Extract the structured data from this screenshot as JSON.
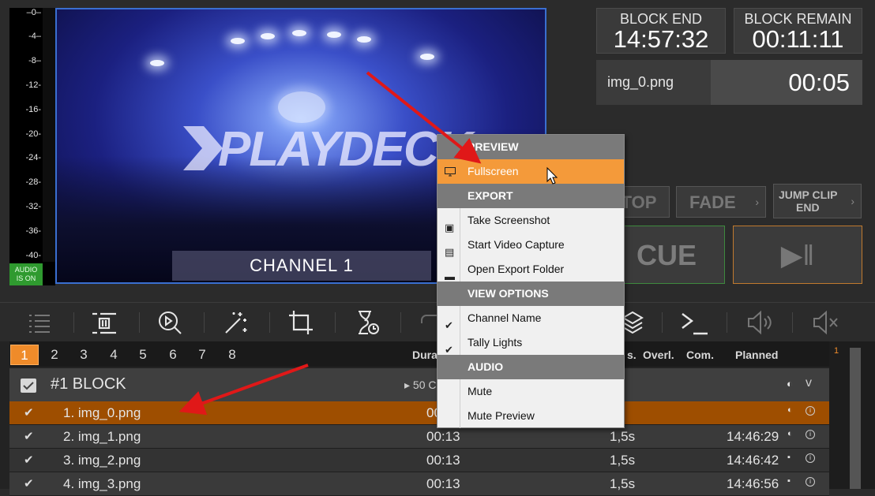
{
  "vu": {
    "ticks": [
      "–0–",
      "-4–",
      "-8–",
      "-12-",
      "-16-",
      "-20-",
      "-24-",
      "-28-",
      "-32-",
      "-36-",
      "-40-"
    ],
    "badge_line1": "AUDIO",
    "badge_line2": "IS ON"
  },
  "preview": {
    "logo": "PLAYDECK",
    "channel_name": "CHANNEL 1"
  },
  "clocks": {
    "block_end_label": "BLOCK END",
    "block_end_value": "14:57:32",
    "block_remain_label": "BLOCK REMAIN",
    "block_remain_value": "00:11:11",
    "clip_name": "img_0.png",
    "clip_time": "00:05"
  },
  "transport": {
    "stop": "TOP",
    "fade": "FADE",
    "jump_line1": "JUMP CLIP",
    "jump_line2": "END",
    "arrow": "›",
    "cue": "CUE",
    "play": "▶‖"
  },
  "toolbar": {
    "icons": [
      "list-icon",
      "stop-after-icon",
      "search-play-icon",
      "magic-wand-icon",
      "crop-icon",
      "hourglass-icon",
      "loop-icon",
      "layers-icon",
      "terminal-icon",
      "volume-icon",
      "mute-icon"
    ]
  },
  "playlist": {
    "tabs": [
      "1",
      "2",
      "3",
      "4",
      "5",
      "6",
      "7",
      "8"
    ],
    "headers": {
      "duration": "Dura",
      "trans": "s.",
      "overlay": "Overl.",
      "comment": "Com.",
      "planned": "Planned"
    },
    "block": {
      "title": "#1  BLOCK",
      "duration": "▸ 50 C",
      "expand": "v"
    },
    "rows": [
      {
        "check": "✔",
        "name": "1. img_0.png",
        "duration": "00",
        "overlay": "5s",
        "planned": "",
        "icon1": "◐",
        "info": "i"
      },
      {
        "check": "✔",
        "name": "2. img_1.png",
        "duration": "00:13",
        "overlay": "1,5s",
        "planned": "14:46:29",
        "icon1": "◐",
        "info": "i"
      },
      {
        "check": "✔",
        "name": "3. img_2.png",
        "duration": "00:13",
        "overlay": "1,5s",
        "planned": "14:46:42",
        "icon1": "▪",
        "info": "i"
      },
      {
        "check": "✔",
        "name": "4. img_3.png",
        "duration": "00:13",
        "overlay": "1,5s",
        "planned": "14:46:56",
        "icon1": "▪",
        "info": "i"
      }
    ],
    "strip_number": "1"
  },
  "context_menu": {
    "sections": [
      {
        "title": "PREVIEW",
        "items": [
          {
            "label": "Fullscreen",
            "icon": "monitor-icon",
            "glyph": "🖥",
            "highlighted": true
          }
        ]
      },
      {
        "title": "EXPORT",
        "items": [
          {
            "label": "Take Screenshot",
            "icon": "image-icon",
            "glyph": "▣"
          },
          {
            "label": "Start Video Capture",
            "icon": "film-icon",
            "glyph": "▤"
          },
          {
            "label": "Open Export Folder",
            "icon": "folder-icon",
            "glyph": "▬"
          }
        ]
      },
      {
        "title": "VIEW OPTIONS",
        "items": [
          {
            "label": "Channel Name",
            "icon": "check-icon",
            "glyph": "✔"
          },
          {
            "label": "Tally Lights",
            "icon": "check-icon",
            "glyph": "✔"
          }
        ]
      },
      {
        "title": "AUDIO",
        "items": [
          {
            "label": "Mute",
            "icon": "",
            "glyph": ""
          },
          {
            "label": "Mute Preview",
            "icon": "",
            "glyph": ""
          }
        ]
      }
    ]
  },
  "colors": {
    "accent": "#ef8b2a",
    "highlight": "#f49a3a",
    "selected_row": "#9e4e00",
    "arrow": "#e01818",
    "cue_border": "#3e8a3e",
    "play_border": "#c07a2e"
  }
}
